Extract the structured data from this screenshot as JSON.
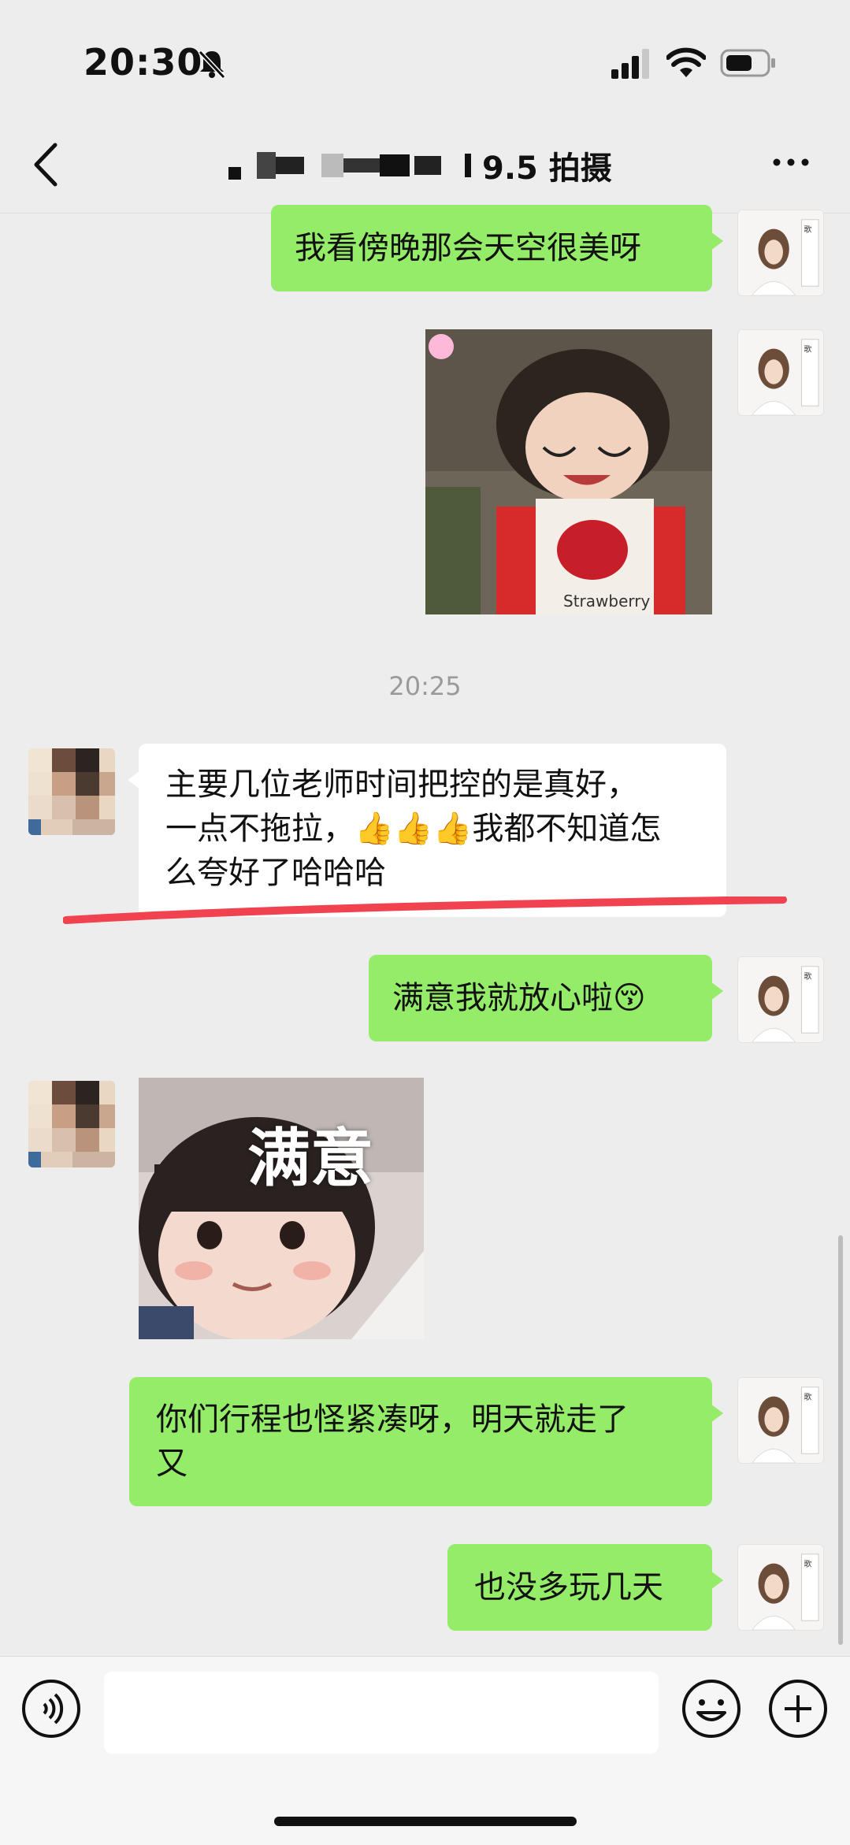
{
  "status_bar": {
    "time": "20:30"
  },
  "header": {
    "title": "9.5 拍摄",
    "title_redacted": true
  },
  "messages": {
    "m1": {
      "text": "我看傍晚那会天空很美呀",
      "sender": "me"
    },
    "m2": {
      "type": "sticker",
      "sender": "me"
    },
    "timestamp": "20:25",
    "m3": {
      "line1": "主要几位老师时间把控的是真好，",
      "line2_a": "一点不拖拉，",
      "line2_emoji": "👍👍👍",
      "line2_b": "我都不知道怎",
      "line3": "么夸好了哈哈哈",
      "sender": "other"
    },
    "m4": {
      "text": "满意我就放心啦",
      "emoji": "😚",
      "sender": "me"
    },
    "m5": {
      "type": "sticker",
      "caption": "满意",
      "sender": "other"
    },
    "m6": {
      "line1": "你们行程也怪紧凑呀，明天就走了",
      "line2": "又",
      "sender": "me"
    },
    "m7": {
      "text": "也没多玩几天",
      "sender": "me"
    }
  },
  "colors": {
    "bubble_me": "#95ec69",
    "bubble_other": "#ffffff",
    "background": "#ededed",
    "annotation": "#f0434f"
  },
  "input": {
    "placeholder": ""
  }
}
